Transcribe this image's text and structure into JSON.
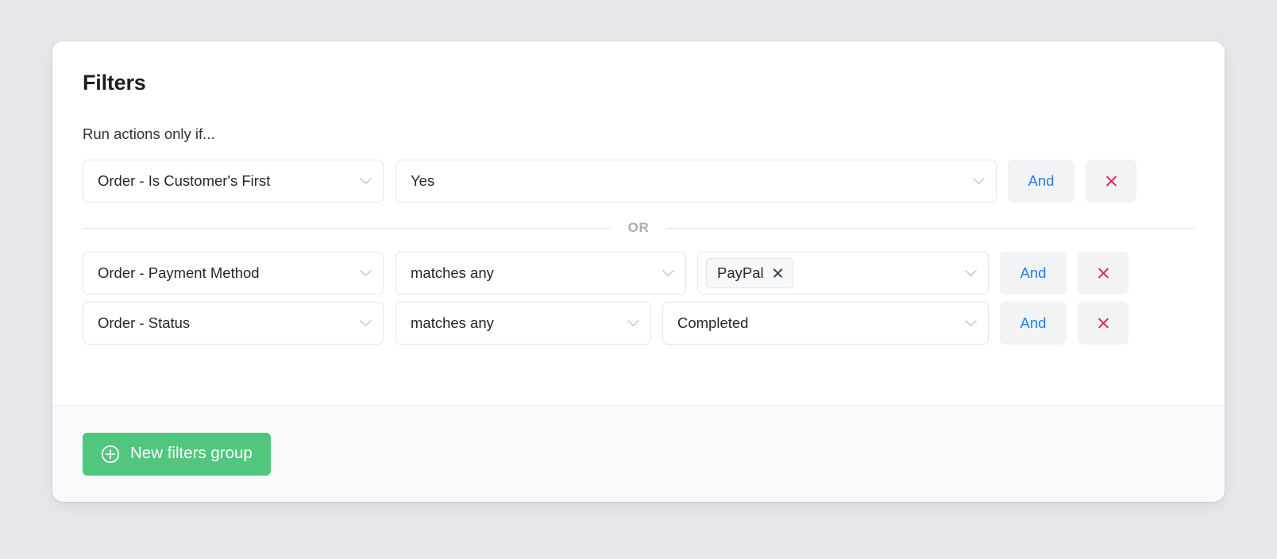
{
  "card": {
    "title": "Filters",
    "subtitle": "Run actions only if..."
  },
  "divider": {
    "or_label": "OR"
  },
  "groups": [
    {
      "rows": [
        {
          "subject": "Order - Is Customer's First",
          "value": "Yes",
          "and_label": "And",
          "remove_label": "×"
        }
      ]
    },
    {
      "rows": [
        {
          "subject": "Order - Payment Method",
          "operator": "matches any",
          "tags": [
            "PayPal"
          ],
          "and_label": "And",
          "remove_label": "×"
        },
        {
          "subject": "Order - Status",
          "operator": "matches any",
          "value": "Completed",
          "and_label": "And",
          "remove_label": "×"
        }
      ]
    }
  ],
  "footer": {
    "new_group_label": "New filters group",
    "new_group_icon": "plus-circle-icon"
  },
  "colors": {
    "page_background": "#e6e7eb",
    "card_background": "#ffffff",
    "footer_background": "#f8f9fb",
    "accent_green": "#51c67e",
    "accent_blue": "#2680eb",
    "accent_red": "#e0215c",
    "button_grey": "#f2f3f5",
    "border": "#e3e5e8"
  }
}
